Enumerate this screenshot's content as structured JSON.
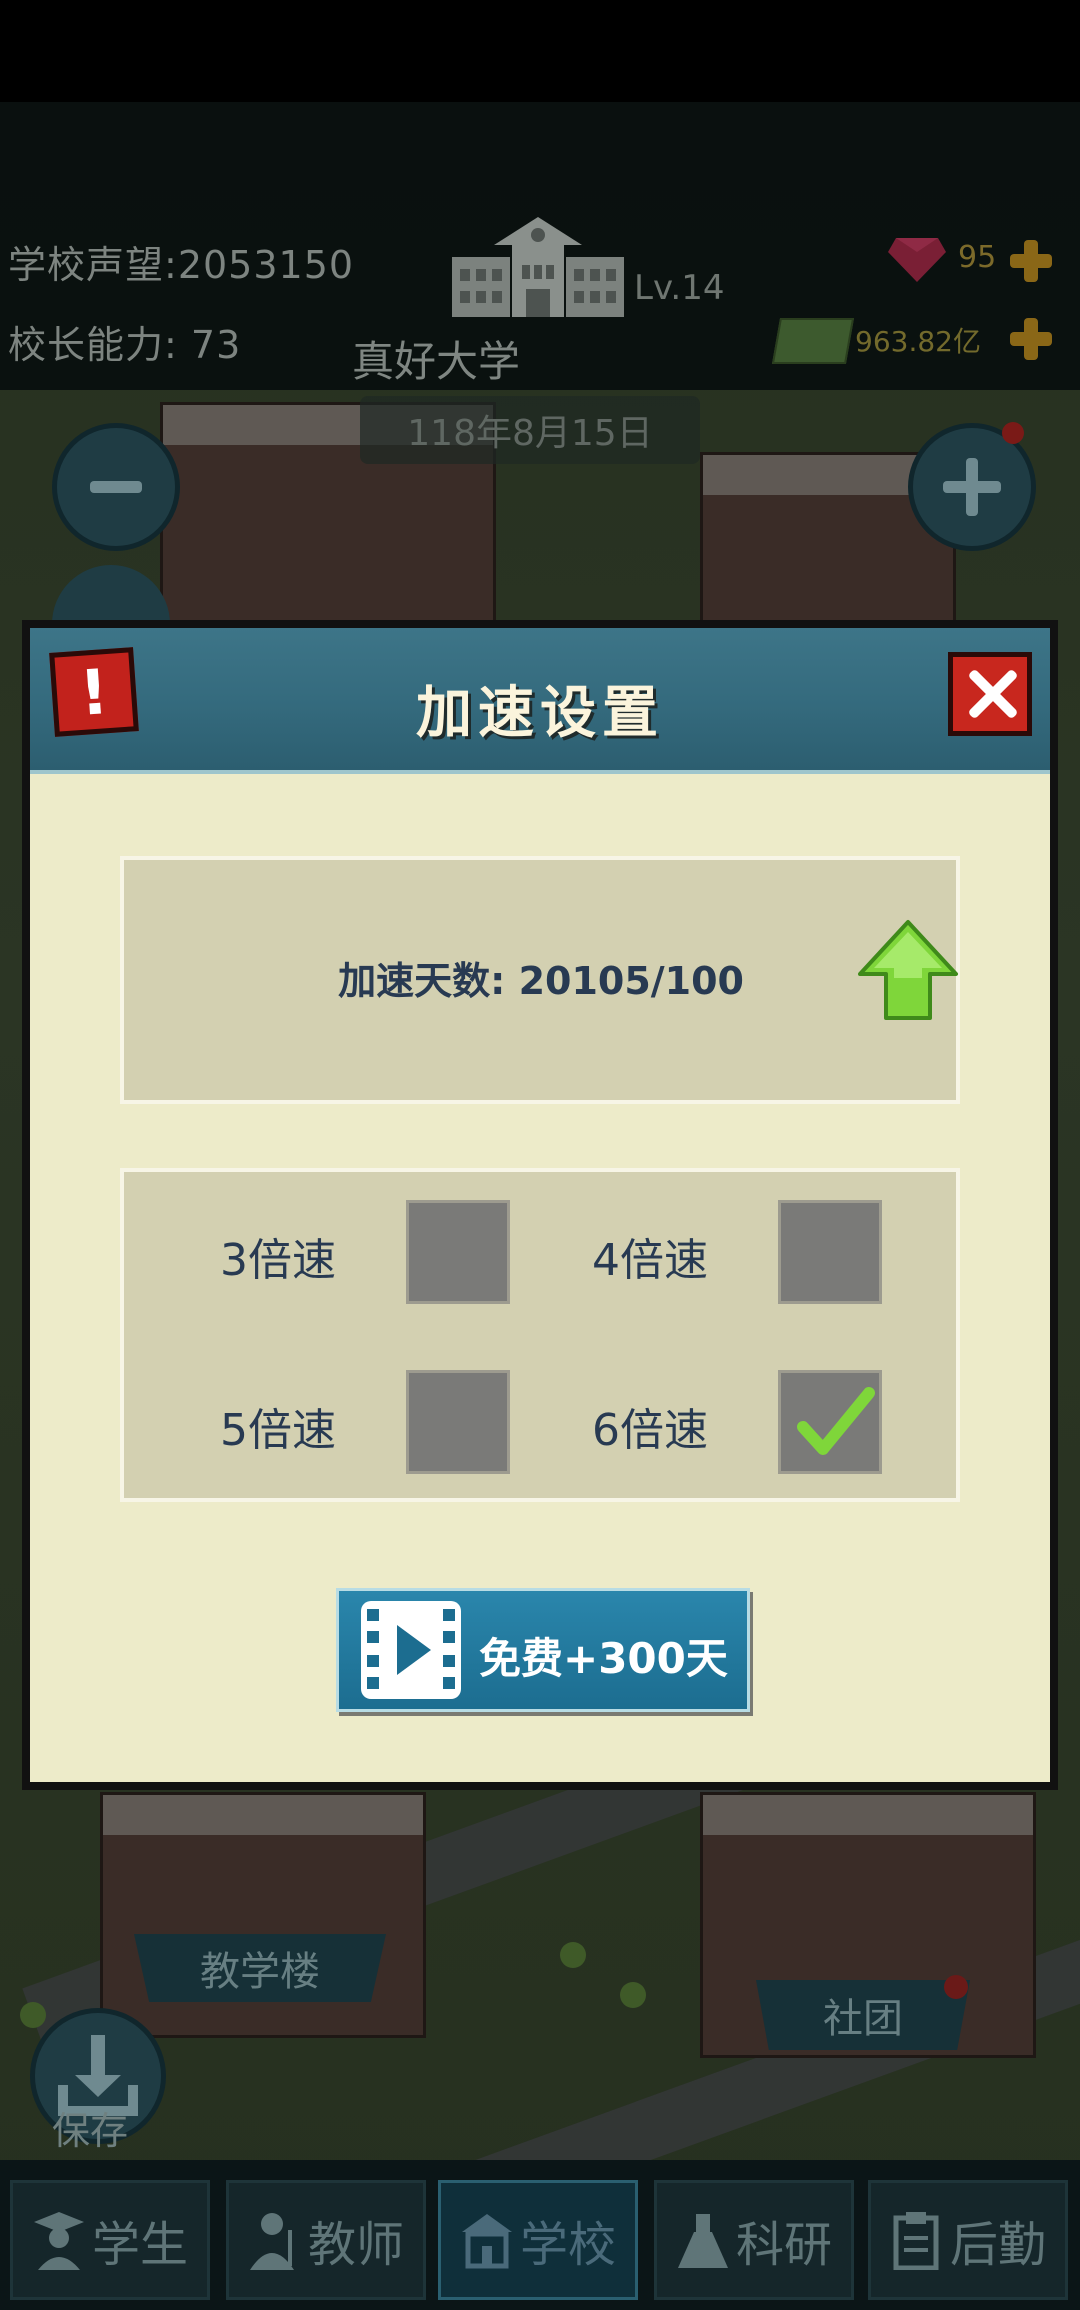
{
  "hud": {
    "reputation_label": "学校声望:",
    "reputation_value": "2053150",
    "ability_label": "校长能力:",
    "ability_value": "73",
    "level": "Lv.14",
    "school_name": "真好大学",
    "date": "118年8月15日",
    "gems": "95",
    "money": "963.82亿"
  },
  "dialog": {
    "title": "加速设置",
    "days_label": "加速天数:",
    "days_value": "20105/100",
    "speeds": [
      {
        "label": "3倍速",
        "checked": false
      },
      {
        "label": "4倍速",
        "checked": false
      },
      {
        "label": "5倍速",
        "checked": false
      },
      {
        "label": "6倍速",
        "checked": true
      }
    ],
    "free_button": "免费+300天"
  },
  "map": {
    "building_label": "教学楼",
    "club_label": "社团",
    "save_label": "保存"
  },
  "tabs": [
    {
      "label": "学生",
      "icon": "student-icon",
      "active": false
    },
    {
      "label": "教师",
      "icon": "teacher-icon",
      "active": false
    },
    {
      "label": "学校",
      "icon": "school-icon",
      "active": true
    },
    {
      "label": "科研",
      "icon": "research-icon",
      "active": false
    },
    {
      "label": "后勤",
      "icon": "logistics-icon",
      "active": false
    }
  ],
  "colors": {
    "accent_green": "#7fd63a",
    "dialog_header": "#346a7d",
    "close_red": "#c8271e"
  }
}
